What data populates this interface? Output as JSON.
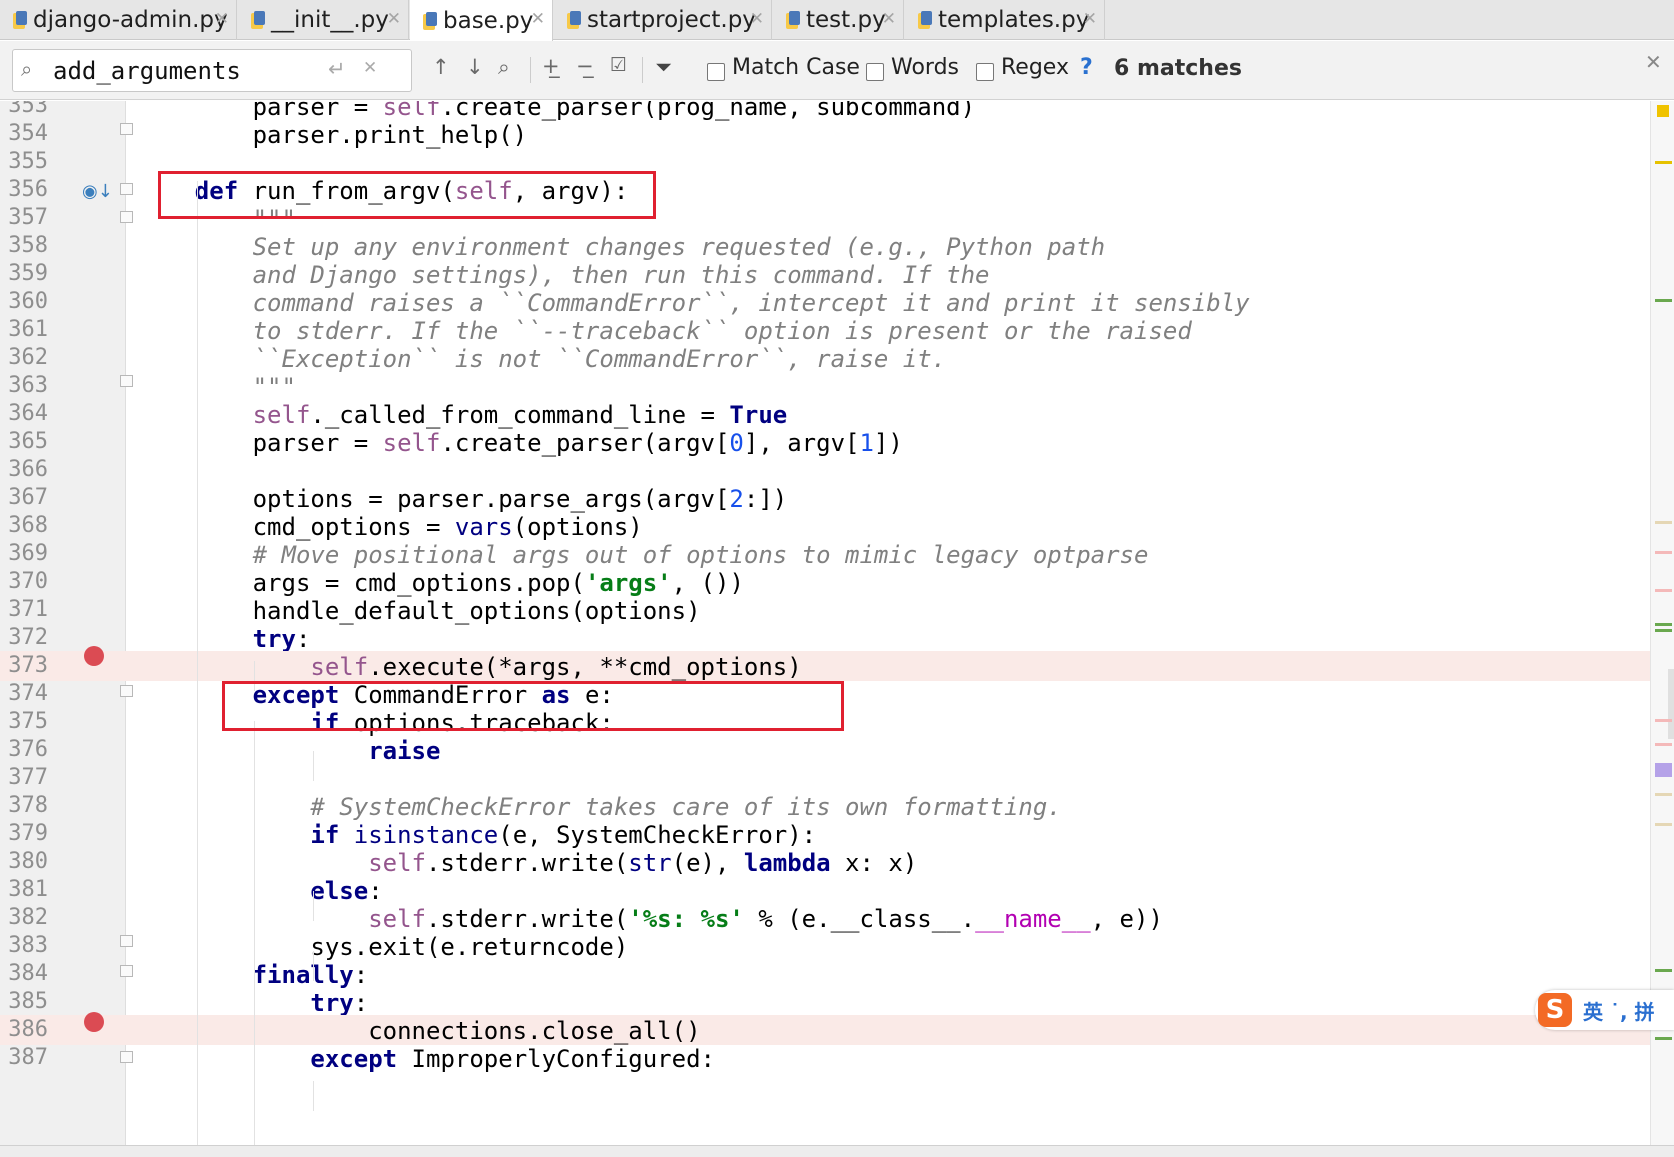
{
  "tabs": [
    {
      "label": "django-admin.py",
      "active": false
    },
    {
      "label": "__init__.py",
      "active": false
    },
    {
      "label": "base.py",
      "active": true
    },
    {
      "label": "startproject.py",
      "active": false
    },
    {
      "label": "test.py",
      "active": false
    },
    {
      "label": "templates.py",
      "active": false
    }
  ],
  "search": {
    "query": "add_arguments",
    "match_case_label": "Match Case",
    "words_label": "Words",
    "regex_label": "Regex",
    "help": "?",
    "matches": "6 matches"
  },
  "icons": {
    "tab_file": "python-file-icon",
    "search": "search-icon",
    "enter": "enter-icon",
    "clear": "clear-icon",
    "prev": "arrow-up-icon",
    "next": "arrow-down-icon",
    "find_all": "find-all-icon",
    "add_selection": "add-occurrence-icon",
    "remove_selection": "remove-occurrence-icon",
    "select_all": "select-all-occurrences-icon",
    "filter": "filter-icon",
    "breakpoint": "breakpoint-icon",
    "override": "override-icon"
  },
  "colors": {
    "keyword": "#000080",
    "self": "#94558d",
    "number": "#1750eb",
    "string": "#067d17",
    "comment": "#808080",
    "breakpoint": "#db4b53",
    "highlight_box": "#e02030"
  },
  "editor": {
    "lines": [
      {
        "n": "353",
        "text": "        parser = self.create_parser(prog_name, subcommand)"
      },
      {
        "n": "354",
        "text": "        parser.print_help()"
      },
      {
        "n": "355",
        "text": ""
      },
      {
        "n": "356",
        "text": "    def run_from_argv(self, argv):"
      },
      {
        "n": "357",
        "text": "        \"\"\""
      },
      {
        "n": "358",
        "text": "        Set up any environment changes requested (e.g., Python path"
      },
      {
        "n": "359",
        "text": "        and Django settings), then run this command. If the"
      },
      {
        "n": "360",
        "text": "        command raises a ``CommandError``, intercept it and print it sensibly"
      },
      {
        "n": "361",
        "text": "        to stderr. If the ``--traceback`` option is present or the raised"
      },
      {
        "n": "362",
        "text": "        ``Exception`` is not ``CommandError``, raise it."
      },
      {
        "n": "363",
        "text": "        \"\"\""
      },
      {
        "n": "364",
        "text": "        self._called_from_command_line = True"
      },
      {
        "n": "365",
        "text": "        parser = self.create_parser(argv[0], argv[1])"
      },
      {
        "n": "366",
        "text": ""
      },
      {
        "n": "367",
        "text": "        options = parser.parse_args(argv[2:])"
      },
      {
        "n": "368",
        "text": "        cmd_options = vars(options)"
      },
      {
        "n": "369",
        "text": "        # Move positional args out of options to mimic legacy optparse"
      },
      {
        "n": "370",
        "text": "        args = cmd_options.pop('args', ())"
      },
      {
        "n": "371",
        "text": "        handle_default_options(options)"
      },
      {
        "n": "372",
        "text": "        try:"
      },
      {
        "n": "373",
        "text": "            self.execute(*args, **cmd_options)"
      },
      {
        "n": "374",
        "text": "        except CommandError as e:"
      },
      {
        "n": "375",
        "text": "            if options.traceback:"
      },
      {
        "n": "376",
        "text": "                raise"
      },
      {
        "n": "377",
        "text": ""
      },
      {
        "n": "378",
        "text": "            # SystemCheckError takes care of its own formatting."
      },
      {
        "n": "379",
        "text": "            if isinstance(e, SystemCheckError):"
      },
      {
        "n": "380",
        "text": "                self.stderr.write(str(e), lambda x: x)"
      },
      {
        "n": "381",
        "text": "            else:"
      },
      {
        "n": "382",
        "text": "                self.stderr.write('%s: %s' % (e.__class__.__name__, e))"
      },
      {
        "n": "383",
        "text": "            sys.exit(e.returncode)"
      },
      {
        "n": "384",
        "text": "        finally:"
      },
      {
        "n": "385",
        "text": "            try:"
      },
      {
        "n": "386",
        "text": "                connections.close_all()"
      },
      {
        "n": "387",
        "text": "            except ImproperlyConfigured:"
      }
    ],
    "breakpoint_lines": [
      "373",
      "386"
    ],
    "override_line": "356"
  },
  "ime": {
    "logo": "S",
    "text": "英 ˙, 拼"
  }
}
